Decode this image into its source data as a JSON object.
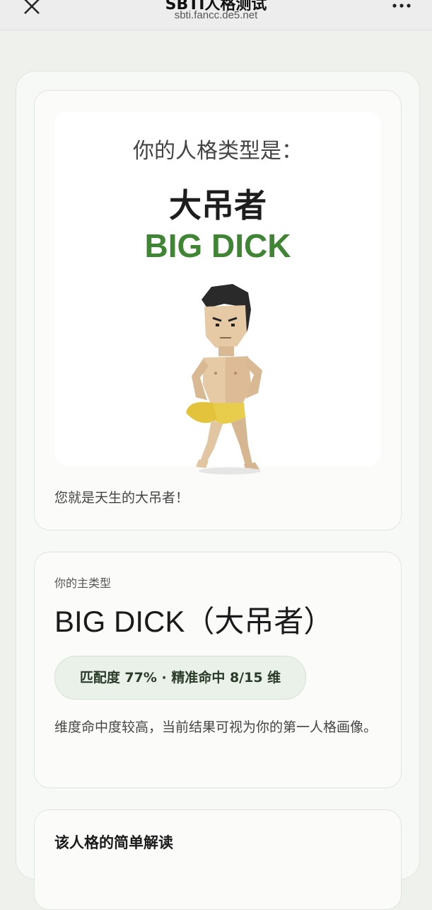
{
  "browser": {
    "title": "SBTI人格测试",
    "url": "sbti.fancc.de5.net",
    "close_icon": "close-icon",
    "more_icon": "more-icon"
  },
  "result": {
    "label": "你的人格类型是：",
    "name_cn": "大吊者",
    "name_en": "BIG DICK",
    "caption": "您就是天生的大吊者！"
  },
  "main_type": {
    "label": "你的主类型",
    "title": "BIG DICK（大吊者）",
    "match": "匹配度 77% · 精准命中 8/15 维",
    "description": "维度命中度较高，当前结果可视为你的第一人格画像。"
  },
  "interpretation": {
    "title": "该人格的简单解读"
  },
  "colors": {
    "accent_green": "#3f8534",
    "badge_bg": "#eaf1e8"
  }
}
